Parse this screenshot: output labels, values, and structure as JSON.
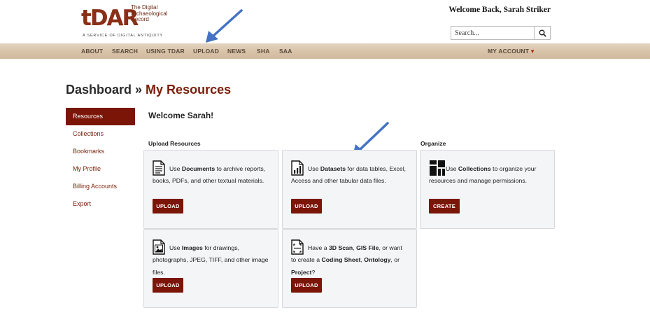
{
  "logo": {
    "mark": "tDAR",
    "lines": [
      "The Digital",
      "Archaeological",
      "Record"
    ],
    "tagline": "A SERVICE OF DIGITAL ANTIQUITY",
    "brand_color": "#8a2f17"
  },
  "header": {
    "welcome": "Welcome Back, Sarah Striker",
    "search_placeholder": "Search...",
    "search_icon": "search-icon"
  },
  "nav": {
    "items": [
      "ABOUT",
      "SEARCH",
      "USING TDAR",
      "UPLOAD",
      "NEWS",
      "SHA",
      "SAA"
    ],
    "account": "MY ACCOUNT",
    "account_icon": "caret-down-icon"
  },
  "page": {
    "title_prefix": "Dashboard",
    "title_sep": " » ",
    "title_accent": "My Resources",
    "accent_color": "#7a1508"
  },
  "sidebar": {
    "items": [
      "Resources",
      "Collections",
      "Bookmarks",
      "My Profile",
      "Billing Accounts",
      "Export"
    ],
    "active": "Resources"
  },
  "main": {
    "welcome": "Welcome Sarah!",
    "upload_label": "Upload Resources",
    "organize_label": "Organize"
  },
  "cards": [
    {
      "icon": "document-icon",
      "pre": "Use ",
      "bold1": "Documents",
      "mid": " to archive reports, books, PDFs, and other textual materials.",
      "bold2": "",
      "mid2": "",
      "bold3": "",
      "post": "",
      "button": "UPLOAD"
    },
    {
      "icon": "dataset-icon",
      "pre": "Use ",
      "bold1": "Datasets",
      "mid": " for data tables, Excel, Access and other tabular data files.",
      "bold2": "",
      "mid2": "",
      "bold3": "",
      "post": "",
      "button": "UPLOAD"
    },
    {
      "icon": "collection-icon",
      "pre": "Use ",
      "bold1": "Collections",
      "mid": " to organize your resources and manage permissions.",
      "bold2": "",
      "mid2": "",
      "bold3": "",
      "post": "",
      "button": "CREATE"
    },
    {
      "icon": "image-icon",
      "pre": "Use ",
      "bold1": "Images",
      "mid": " for drawings, photographs, JPEG, TIFF, and other image files.",
      "bold2": "",
      "mid2": "",
      "bold3": "",
      "post": "",
      "button": "UPLOAD"
    },
    {
      "icon": "scan-icon",
      "pre": "Have a ",
      "bold1": "3D Scan",
      "mid": ", ",
      "bold2": "GIS File",
      "mid2": ", or want to create a ",
      "bold3": "Coding Sheet",
      "post": ", ",
      "bold4": "Ontology",
      "post2": ", or ",
      "bold5": "Project",
      "post3": "?",
      "button": "UPLOAD"
    }
  ]
}
